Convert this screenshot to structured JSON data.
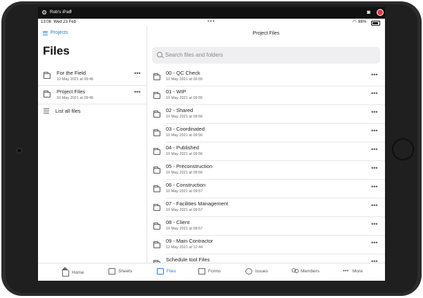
{
  "recording_bar": {
    "device_name": "Rob's iPad",
    "close": "×"
  },
  "status_bar": {
    "time": "13:08",
    "date": "Wed 23 Feb",
    "battery": "98%"
  },
  "sidebar": {
    "back_link": "Projects",
    "title": "Files",
    "items": [
      {
        "name": "For the Field",
        "date": "10 May 2021 at 09:45"
      },
      {
        "name": "Project Files",
        "date": "10 May 2021 at 09:45"
      }
    ],
    "list_all": "List all files"
  },
  "main": {
    "title": "Project Files",
    "search_placeholder": "Search files and folders",
    "folders": [
      {
        "name": "00 - QC Check",
        "date": "10 May 2021 at 09:55"
      },
      {
        "name": "01 - WIP",
        "date": "10 May 2021 at 09:55"
      },
      {
        "name": "02 - Shared",
        "date": "10 May 2021 at 09:56"
      },
      {
        "name": "03 - Coordinated",
        "date": "10 May 2021 at 09:56"
      },
      {
        "name": "04 - Published",
        "date": "10 May 2021 at 09:56"
      },
      {
        "name": "05 - Preconstruction",
        "date": "10 May 2021 at 09:56"
      },
      {
        "name": "06 - Construction",
        "date": "10 May 2021 at 09:57"
      },
      {
        "name": "07 - Facilities Management",
        "date": "10 May 2021 at 09:57"
      },
      {
        "name": "08 - Client",
        "date": "10 May 2021 at 09:57"
      },
      {
        "name": "09 - Main Contractor",
        "date": "12 May 2021 at 12:44"
      },
      {
        "name": "Schedule tool Files",
        "date": ""
      }
    ]
  },
  "tabbar": {
    "items": [
      {
        "label": "Home",
        "icon": "home-icon"
      },
      {
        "label": "Sheets",
        "icon": "sheets-icon"
      },
      {
        "label": "Files",
        "icon": "files-icon",
        "active": true
      },
      {
        "label": "Forms",
        "icon": "forms-icon"
      },
      {
        "label": "Issues",
        "icon": "issues-icon"
      },
      {
        "label": "Members",
        "icon": "members-icon"
      },
      {
        "label": "More",
        "icon": "more-icon"
      }
    ]
  },
  "colors": {
    "accent": "#2b7bd6",
    "bezel": "#2b2b2b",
    "record": "#e03a3a"
  }
}
